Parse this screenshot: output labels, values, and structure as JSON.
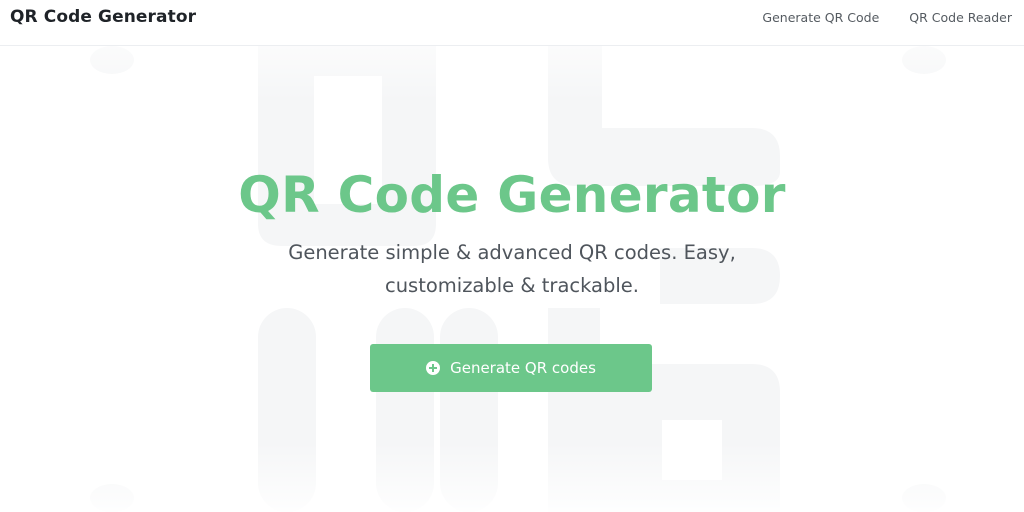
{
  "header": {
    "brand": "QR Code Generator",
    "nav": [
      {
        "label": "Generate QR Code"
      },
      {
        "label": "QR Code Reader"
      }
    ]
  },
  "hero": {
    "title": "QR Code Generator",
    "subtitle": "Generate simple & advanced QR codes. Easy, customizable & trackable.",
    "cta_label": "Generate QR codes",
    "cta_icon": "plus-circle-icon"
  },
  "colors": {
    "accent": "#6cc78a",
    "text_dark": "#1f2328",
    "text_muted": "#4f555c",
    "background_shape": "#f6f7f8"
  }
}
